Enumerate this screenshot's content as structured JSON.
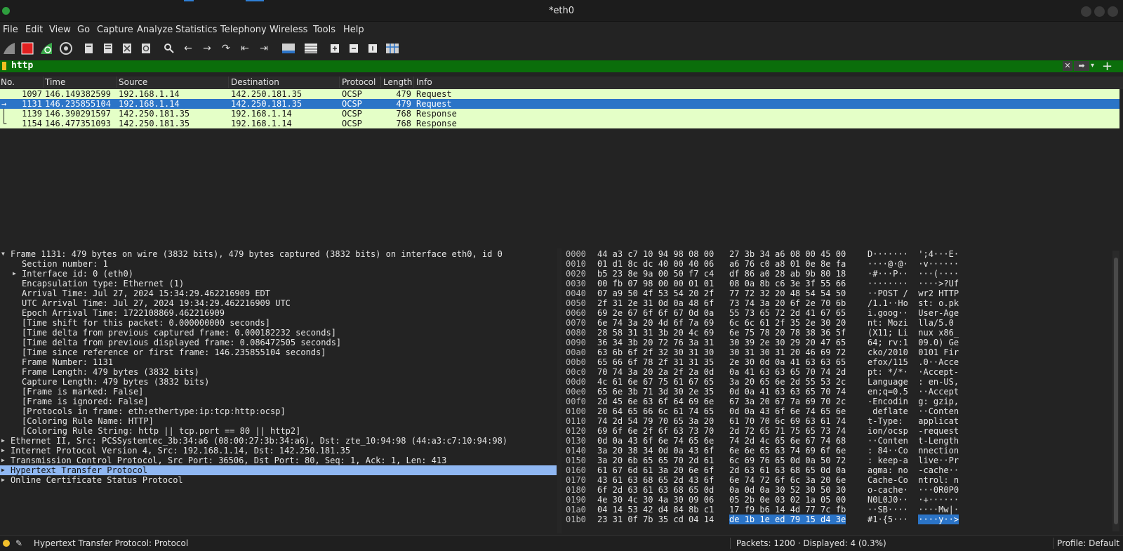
{
  "window": {
    "title": "*eth0"
  },
  "menu": [
    "File",
    "Edit",
    "View",
    "Go",
    "Capture",
    "Analyze",
    "Statistics",
    "Telephony",
    "Wireless",
    "Tools",
    "Help"
  ],
  "toolbar": {
    "icons": [
      "shark-fin-start-icon",
      "stop-capture-icon",
      "restart-capture-icon",
      "capture-options-icon",
      "open-file-icon",
      "save-file-icon",
      "close-file-icon",
      "reload-icon",
      "find-icon",
      "go-back-icon",
      "go-forward-icon",
      "go-to-packet-icon",
      "first-packet-icon",
      "last-packet-icon",
      "autoscroll-icon",
      "colorize-icon",
      "zoom-in-icon",
      "zoom-out-icon",
      "zoom-normal-icon",
      "resize-columns-icon"
    ]
  },
  "filter": {
    "value": "http"
  },
  "packet_list": {
    "columns": [
      "No.",
      "Time",
      "Source",
      "Destination",
      "Protocol",
      "Length",
      "Info"
    ],
    "rows": [
      {
        "no": "1097",
        "time": "146.149382599",
        "src": "192.168.1.14",
        "dst": "142.250.181.35",
        "proto": "OCSP",
        "len": "479",
        "info": "Request"
      },
      {
        "no": "1131",
        "time": "146.235855104",
        "src": "192.168.1.14",
        "dst": "142.250.181.35",
        "proto": "OCSP",
        "len": "479",
        "info": "Request"
      },
      {
        "no": "1139",
        "time": "146.390291597",
        "src": "142.250.181.35",
        "dst": "192.168.1.14",
        "proto": "OCSP",
        "len": "768",
        "info": "Response"
      },
      {
        "no": "1154",
        "time": "146.477351093",
        "src": "142.250.181.35",
        "dst": "192.168.1.14",
        "proto": "OCSP",
        "len": "768",
        "info": "Response"
      }
    ]
  },
  "details": [
    "Frame 1131: 479 bytes on wire (3832 bits), 479 bytes captured (3832 bits) on interface eth0, id 0",
    "Section number: 1",
    "Interface id: 0 (eth0)",
    "Encapsulation type: Ethernet (1)",
    "Arrival Time: Jul 27, 2024 15:34:29.462216909 EDT",
    "UTC Arrival Time: Jul 27, 2024 19:34:29.462216909 UTC",
    "Epoch Arrival Time: 1722108869.462216909",
    "[Time shift for this packet: 0.000000000 seconds]",
    "[Time delta from previous captured frame: 0.000182232 seconds]",
    "[Time delta from previous displayed frame: 0.086472505 seconds]",
    "[Time since reference or first frame: 146.235855104 seconds]",
    "Frame Number: 1131",
    "Frame Length: 479 bytes (3832 bits)",
    "Capture Length: 479 bytes (3832 bits)",
    "[Frame is marked: False]",
    "[Frame is ignored: False]",
    "[Protocols in frame: eth:ethertype:ip:tcp:http:ocsp]",
    "[Coloring Rule Name: HTTP]",
    "[Coloring Rule String: http || tcp.port == 80 || http2]",
    "Ethernet II, Src: PCSSystemtec_3b:34:a6 (08:00:27:3b:34:a6), Dst: zte_10:94:98 (44:a3:c7:10:94:98)",
    "Internet Protocol Version 4, Src: 192.168.1.14, Dst: 142.250.181.35",
    "Transmission Control Protocol, Src Port: 36506, Dst Port: 80, Seq: 1, Ack: 1, Len: 413",
    "Hypertext Transfer Protocol",
    "Online Certificate Status Protocol"
  ],
  "hex": [
    {
      "off": "0000",
      "h1": "44 a3 c7 10 94 98 08 00",
      "h2": "27 3b 34 a6 08 00 45 00",
      "a": "D·······  ';4···E·"
    },
    {
      "off": "0010",
      "h1": "01 d1 8c dc 40 00 40 06",
      "h2": "a6 76 c0 a8 01 0e 8e fa",
      "a": "····@·@·  ·v······"
    },
    {
      "off": "0020",
      "h1": "b5 23 8e 9a 00 50 f7 c4",
      "h2": "df 86 a0 28 ab 9b 80 18",
      "a": "·#···P··  ···(····"
    },
    {
      "off": "0030",
      "h1": "00 fb 07 98 00 00 01 01",
      "h2": "08 0a 8b c6 3e 3f 55 66",
      "a": "········  ····>?Uf"
    },
    {
      "off": "0040",
      "h1": "07 a9 50 4f 53 54 20 2f",
      "h2": "77 72 32 20 48 54 54 50",
      "a": "··POST /  wr2 HTTP"
    },
    {
      "off": "0050",
      "h1": "2f 31 2e 31 0d 0a 48 6f",
      "h2": "73 74 3a 20 6f 2e 70 6b",
      "a": "/1.1··Ho  st: o.pk"
    },
    {
      "off": "0060",
      "h1": "69 2e 67 6f 6f 67 0d 0a",
      "h2": "55 73 65 72 2d 41 67 65",
      "a": "i.goog··  User-Age"
    },
    {
      "off": "0070",
      "h1": "6e 74 3a 20 4d 6f 7a 69",
      "h2": "6c 6c 61 2f 35 2e 30 20",
      "a": "nt: Mozi  lla/5.0 "
    },
    {
      "off": "0080",
      "h1": "28 58 31 31 3b 20 4c 69",
      "h2": "6e 75 78 20 78 38 36 5f",
      "a": "(X11; Li  nux x86_"
    },
    {
      "off": "0090",
      "h1": "36 34 3b 20 72 76 3a 31",
      "h2": "30 39 2e 30 29 20 47 65",
      "a": "64; rv:1  09.0) Ge"
    },
    {
      "off": "00a0",
      "h1": "63 6b 6f 2f 32 30 31 30",
      "h2": "30 31 30 31 20 46 69 72",
      "a": "cko/2010  0101 Fir"
    },
    {
      "off": "00b0",
      "h1": "65 66 6f 78 2f 31 31 35",
      "h2": "2e 30 0d 0a 41 63 63 65",
      "a": "efox/115  .0··Acce"
    },
    {
      "off": "00c0",
      "h1": "70 74 3a 20 2a 2f 2a 0d",
      "h2": "0a 41 63 63 65 70 74 2d",
      "a": "pt: */*·  ·Accept-"
    },
    {
      "off": "00d0",
      "h1": "4c 61 6e 67 75 61 67 65",
      "h2": "3a 20 65 6e 2d 55 53 2c",
      "a": "Language  : en-US,"
    },
    {
      "off": "00e0",
      "h1": "65 6e 3b 71 3d 30 2e 35",
      "h2": "0d 0a 41 63 63 65 70 74",
      "a": "en;q=0.5  ··Accept"
    },
    {
      "off": "00f0",
      "h1": "2d 45 6e 63 6f 64 69 6e",
      "h2": "67 3a 20 67 7a 69 70 2c",
      "a": "-Encodin  g: gzip,"
    },
    {
      "off": "0100",
      "h1": "20 64 65 66 6c 61 74 65",
      "h2": "0d 0a 43 6f 6e 74 65 6e",
      "a": " deflate  ··Conten"
    },
    {
      "off": "0110",
      "h1": "74 2d 54 79 70 65 3a 20",
      "h2": "61 70 70 6c 69 63 61 74",
      "a": "t-Type:   applicat"
    },
    {
      "off": "0120",
      "h1": "69 6f 6e 2f 6f 63 73 70",
      "h2": "2d 72 65 71 75 65 73 74",
      "a": "ion/ocsp  -request"
    },
    {
      "off": "0130",
      "h1": "0d 0a 43 6f 6e 74 65 6e",
      "h2": "74 2d 4c 65 6e 67 74 68",
      "a": "··Conten  t-Length"
    },
    {
      "off": "0140",
      "h1": "3a 20 38 34 0d 0a 43 6f",
      "h2": "6e 6e 65 63 74 69 6f 6e",
      "a": ": 84··Co  nnection"
    },
    {
      "off": "0150",
      "h1": "3a 20 6b 65 65 70 2d 61",
      "h2": "6c 69 76 65 0d 0a 50 72",
      "a": ": keep-a  live··Pr"
    },
    {
      "off": "0160",
      "h1": "61 67 6d 61 3a 20 6e 6f",
      "h2": "2d 63 61 63 68 65 0d 0a",
      "a": "agma: no  -cache··"
    },
    {
      "off": "0170",
      "h1": "43 61 63 68 65 2d 43 6f",
      "h2": "6e 74 72 6f 6c 3a 20 6e",
      "a": "Cache-Co  ntrol: n"
    },
    {
      "off": "0180",
      "h1": "6f 2d 63 61 63 68 65 0d",
      "h2": "0a 0d 0a 30 52 30 50 30",
      "a": "o-cache·  ···0R0P0"
    },
    {
      "off": "0190",
      "h1": "4e 30 4c 30 4a 30 09 06",
      "h2": "05 2b 0e 03 02 1a 05 00",
      "a": "N0L0J0··  ·+······"
    },
    {
      "off": "01a0",
      "h1": "04 14 53 42 d4 84 8b c1",
      "h2": "17 f9 b6 14 4d 77 7c fb",
      "a": "··SB····  ····Mw|·"
    },
    {
      "off": "01b0",
      "h1": "23 31 0f 7b 35 cd 04 14",
      "h2": "de 1b 1e ed 79 15 d4 3e",
      "a1": "#1·{5···  ",
      "a2": "····y··>"
    }
  ],
  "status": {
    "left": "Hypertext Transfer Protocol: Protocol",
    "packets": "Packets: 1200 · Displayed: 4 (0.3%)",
    "profile": "Profile: Default"
  }
}
